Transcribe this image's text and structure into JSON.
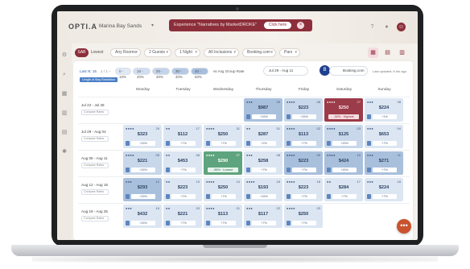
{
  "header": {
    "logo": "OPTI.A",
    "hotel": "Marina Bay Sands",
    "banner_text": "Experience \"Narratives by MarketDROKE\"",
    "banner_button": "Click here"
  },
  "filters": {
    "segment": [
      "SAB",
      "Lowest"
    ],
    "chips": [
      "Any Rooms",
      "2 Guests",
      "1 Night",
      "All Inclusions",
      "Booking.com",
      "Pars"
    ]
  },
  "toolbar": {
    "ranges": "Last N: 15",
    "pager": "1 / 1 ›",
    "pct_filters": [
      "0 - 10%",
      "10 - 20%",
      "20 - 30%",
      "30 - 40%",
      "40 - 50%"
    ],
    "avg_group_rate": "vs Avg Group Rate",
    "date_range": "Jul 29 - Aug 11",
    "source": "Booking.com",
    "last_updated": "Last updated: 8 hrs ago",
    "selected_badge": "Length of Stay Restriction"
  },
  "days": [
    "Monday",
    "Tuesday",
    "Wednesday",
    "Thursday",
    "Friday",
    "Saturday",
    "Sunday"
  ],
  "weeks": [
    {
      "label": "Jul 22 - Jul 28",
      "compare": "Compare Rates"
    },
    {
      "label": "Jul 29 - Aug 04",
      "compare": "Compare Rates"
    },
    {
      "label": "Aug 05 - Aug 11",
      "compare": "Compare Rates"
    },
    {
      "label": "Aug 12 - Aug 18",
      "compare": "Compare Rates"
    },
    {
      "label": "Aug 19 - Aug 25",
      "compare": "Compare Rates"
    }
  ],
  "cells": [
    [
      null,
      null,
      null,
      {
        "dots": "●●●",
        "num": "25",
        "price": "$987",
        "delta": "+15%",
        "tone": "dark"
      },
      {
        "dots": "●●●●",
        "num": "26",
        "price": "$223",
        "delta": "+15%",
        "tone": "mid"
      },
      {
        "dots": "●●●●",
        "num": "27",
        "price": "$250",
        "delta": "-32% · Highest",
        "tone": "red"
      },
      {
        "dots": "●●●",
        "num": "28",
        "price": "$224",
        "delta": "+1%",
        "tone": "light"
      }
    ],
    [
      {
        "dots": "●●●●",
        "num": "29",
        "price": "$323",
        "delta": "+15%",
        "tone": "light"
      },
      {
        "dots": "●●",
        "num": "17",
        "price": "$112",
        "delta": "+7%",
        "tone": "light"
      },
      {
        "dots": "●●●●",
        "num": "31",
        "price": "$250",
        "delta": "+7%",
        "tone": "light"
      },
      {
        "dots": "●●",
        "num": "01",
        "price": "$287",
        "delta": "+2%",
        "tone": "light"
      },
      {
        "dots": "●●●●",
        "num": "02",
        "price": "$113",
        "delta": "+7%",
        "tone": "mid"
      },
      {
        "dots": "●●●●",
        "num": "03",
        "price": "$125",
        "delta": "+15%",
        "tone": "mid"
      },
      {
        "dots": "●●●",
        "num": "04",
        "price": "$653",
        "delta": "+7%",
        "tone": "light"
      }
    ],
    [
      {
        "dots": "●●●●",
        "num": "05",
        "price": "$221",
        "delta": "+15%",
        "tone": "mid"
      },
      {
        "dots": "●●",
        "num": "06",
        "price": "$453",
        "delta": "+7%",
        "tone": "light"
      },
      {
        "dots": "●●●●",
        "num": "07",
        "price": "$290",
        "delta": "-98% · Lowest",
        "tone": "green"
      },
      {
        "dots": "●●●",
        "num": "08",
        "price": "$258",
        "delta": "+7%",
        "tone": "light"
      },
      {
        "dots": "●●●●",
        "num": "09",
        "price": "$223",
        "delta": "+7%",
        "tone": "dark"
      },
      {
        "dots": "●●●●",
        "num": "10",
        "price": "$424",
        "delta": "+15%",
        "tone": "dark"
      },
      {
        "dots": "●●●",
        "num": "11",
        "price": "$271",
        "delta": "+7%",
        "tone": "dark"
      }
    ],
    [
      {
        "dots": "●●●",
        "num": "12",
        "price": "$293",
        "delta": "+15%",
        "tone": "dark"
      },
      {
        "dots": "●●",
        "num": "13",
        "price": "$223",
        "delta": "+7%",
        "tone": "light"
      },
      {
        "dots": "●●●●",
        "num": "14",
        "price": "$250",
        "delta": "+7%",
        "tone": "light"
      },
      {
        "dots": "●●●●",
        "num": "15",
        "price": "$193",
        "delta": "+15%",
        "tone": "light"
      },
      {
        "dots": "●●●●",
        "num": "16",
        "price": "$223",
        "delta": "+7%",
        "tone": "light"
      },
      {
        "dots": "●●",
        "num": "17",
        "price": "$284",
        "delta": "+7%",
        "tone": "light"
      },
      {
        "dots": "●●●",
        "num": "18",
        "price": "$224",
        "delta": "+7%",
        "tone": "light"
      }
    ],
    [
      {
        "dots": "●●●",
        "num": "19",
        "price": "$432",
        "delta": "+15%",
        "tone": "light"
      },
      {
        "dots": "●●",
        "num": "20",
        "price": "$221",
        "delta": "+7%",
        "tone": "light"
      },
      {
        "dots": "●●●●",
        "num": "21",
        "price": "$113",
        "delta": "+7%",
        "tone": "light"
      },
      {
        "dots": "●●●",
        "num": "22",
        "price": "$117",
        "delta": "+7%",
        "tone": "light"
      },
      {
        "dots": "●●●●",
        "num": "23",
        "price": "$250",
        "delta": "+7%",
        "tone": "light"
      },
      null,
      null
    ]
  ],
  "fab_icon": "chat-icon"
}
